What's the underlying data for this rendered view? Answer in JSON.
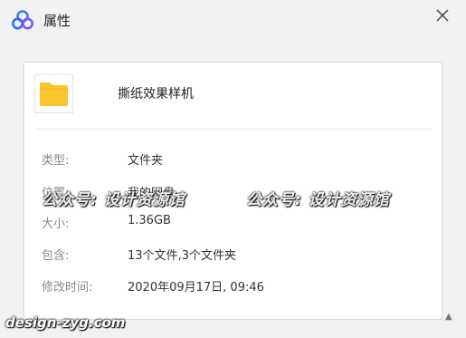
{
  "window": {
    "title": "属性"
  },
  "file": {
    "name": "撕纸效果样机"
  },
  "properties": [
    {
      "label": "类型:",
      "value": "文件夹"
    },
    {
      "label": "位置:",
      "value": "我的网盘"
    },
    {
      "label": "大小:",
      "value": "1.36GB"
    },
    {
      "label": "包含:",
      "value": "13个文件,3个文件夹"
    },
    {
      "label": "修改时间:",
      "value": "2020年09月17日, 09:46"
    }
  ],
  "watermarks": {
    "left": "公众号: 设计资源馆",
    "right": "公众号: 设计资源馆",
    "site": "design-zyg.com"
  },
  "icons": {
    "app": "cloud-logo-icon",
    "close": "close-icon",
    "folder": "folder-icon",
    "corner": "resize-grip-icon"
  },
  "colors": {
    "folder": "#f8c72d",
    "logo_blue": "#3b7cf4",
    "logo_purple": "#7b5cf0"
  }
}
